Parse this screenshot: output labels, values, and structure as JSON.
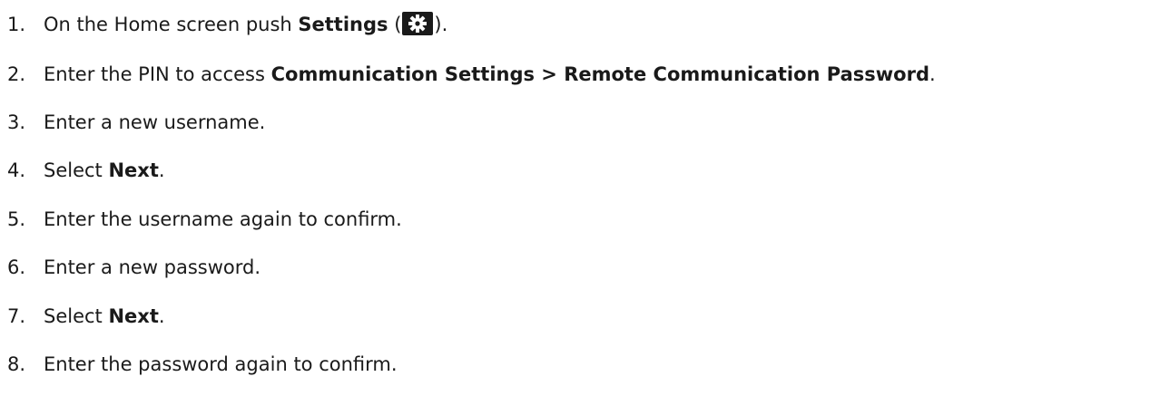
{
  "steps": [
    {
      "number": "1.",
      "pre": "On the Home screen push ",
      "bold": "Settings",
      "paren_open": " (",
      "icon": "settings-gear-icon",
      "paren_close": ")."
    },
    {
      "number": "2.",
      "pre": "Enter the PIN to access ",
      "bold": "Communication Settings > Remote Communication Password",
      "post": "."
    },
    {
      "number": "3.",
      "text": "Enter a new username."
    },
    {
      "number": "4.",
      "pre": "Select ",
      "bold": "Next",
      "post": "."
    },
    {
      "number": "5.",
      "text": "Enter the username again to confirm."
    },
    {
      "number": "6.",
      "text": "Enter a new password."
    },
    {
      "number": "7.",
      "pre": "Select ",
      "bold": "Next",
      "post": "."
    },
    {
      "number": "8.",
      "text": "Enter the password again to confirm."
    }
  ],
  "colors": {
    "text": "#1a1a1a",
    "icon_bg": "#1a1a1a",
    "icon_fg": "#ffffff"
  }
}
